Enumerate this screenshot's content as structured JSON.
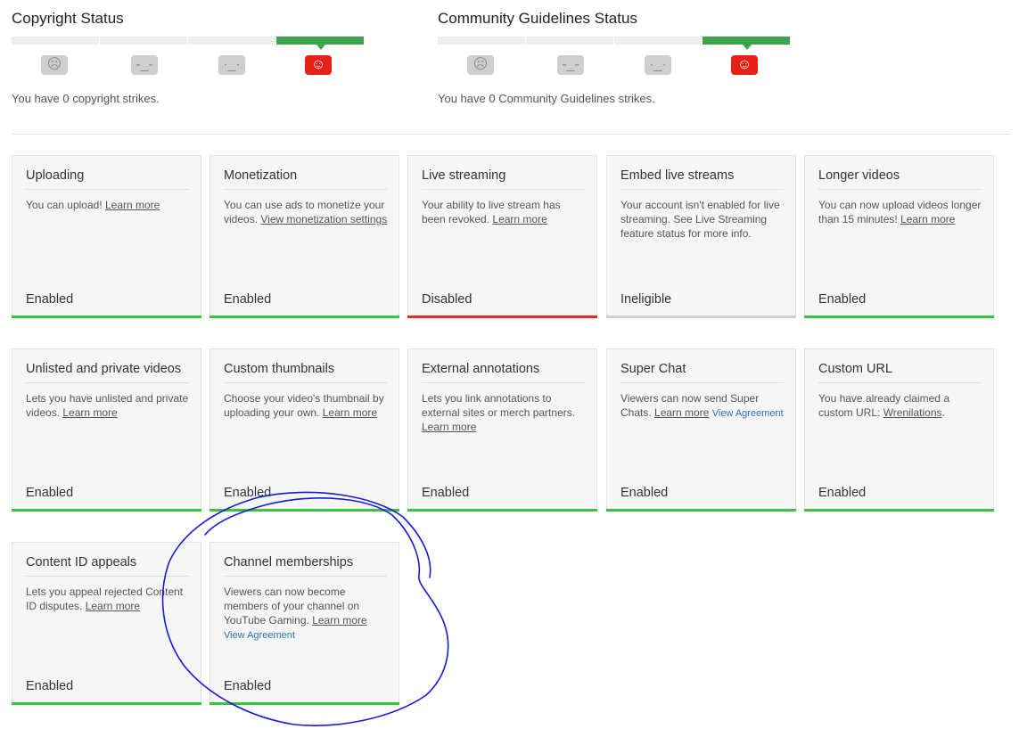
{
  "copyright": {
    "title": "Copyright Status",
    "text": "You have 0 copyright strikes.",
    "faces": [
      "frown-icon",
      "meh-icon",
      "neutral-icon",
      "smile-icon"
    ],
    "active_index": 3
  },
  "community": {
    "title": "Community Guidelines Status",
    "text": "You have 0 Community Guidelines strikes.",
    "faces": [
      "frown-icon",
      "meh-icon",
      "neutral-icon",
      "smile-icon"
    ],
    "active_index": 3
  },
  "colors": {
    "enabled": "#3ec33e",
    "disabled": "#df2a2a",
    "ineligible": "#cfcfcf",
    "active_strike_bar": "#3fa34d",
    "active_face": "#e62117",
    "annotation_ink": "#1a1ad6"
  },
  "cards": {
    "uploading": {
      "title": "Uploading",
      "text": "You can upload! ",
      "link": "Learn more",
      "status": "Enabled"
    },
    "monetization": {
      "title": "Monetization",
      "text": "You can use ads to monetize your videos. ",
      "link": "View monetization settings",
      "status": "Enabled"
    },
    "live_streaming": {
      "title": "Live streaming",
      "text": "Your ability to live stream has been revoked. ",
      "link": "Learn more",
      "status": "Disabled"
    },
    "embed_live": {
      "title": "Embed live streams",
      "text": "Your account isn't enabled for live streaming. See Live Streaming feature status for more info.",
      "status": "Ineligible"
    },
    "longer_videos": {
      "title": "Longer videos",
      "text": "You can now upload videos longer than 15 minutes! ",
      "link": "Learn more",
      "status": "Enabled"
    },
    "unlisted": {
      "title": "Unlisted and private videos",
      "text": "Lets you have unlisted and private videos. ",
      "link": "Learn more",
      "status": "Enabled"
    },
    "thumbnails": {
      "title": "Custom thumbnails",
      "text": "Choose your video's thumbnail by uploading your own. ",
      "link": "Learn more",
      "status": "Enabled"
    },
    "annotations": {
      "title": "External annotations",
      "text": "Lets you link annotations to external sites or merch partners. ",
      "link": "Learn more",
      "status": "Enabled"
    },
    "super_chat": {
      "title": "Super Chat",
      "text": "Viewers can now send Super Chats. ",
      "link": "Learn more",
      "link2": "View Agreement",
      "status": "Enabled"
    },
    "custom_url": {
      "title": "Custom URL",
      "text": "You have already claimed a custom URL: ",
      "link": "Wrenilations",
      "suffix": ".",
      "status": "Enabled"
    },
    "content_id": {
      "title": "Content ID appeals",
      "text": "Lets you appeal rejected Content ID disputes. ",
      "link": "Learn more",
      "status": "Enabled"
    },
    "memberships": {
      "title": "Channel memberships",
      "text": "Viewers can now become members of your channel on YouTube Gaming. ",
      "link": "Learn more",
      "link2": "View Agreement",
      "status": "Enabled"
    }
  }
}
